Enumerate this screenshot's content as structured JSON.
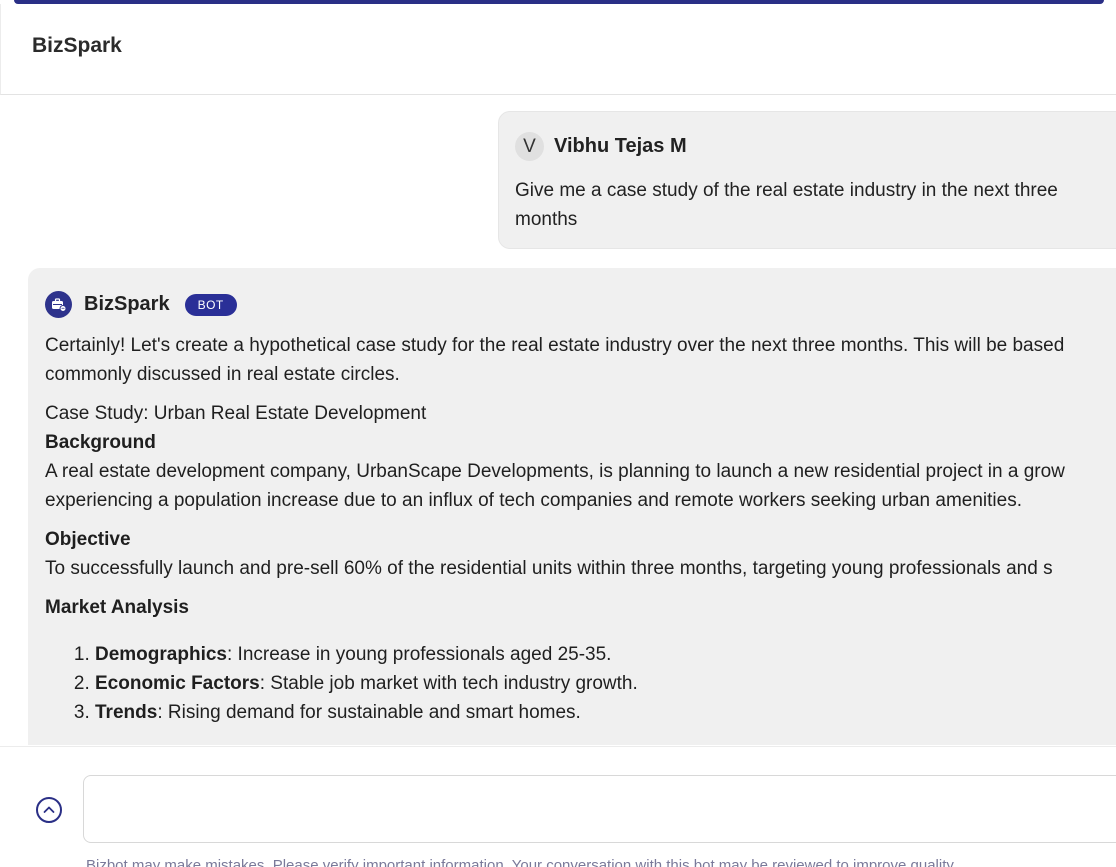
{
  "header": {
    "title": "BizSpark"
  },
  "user_message": {
    "avatar_initial": "V",
    "name": "Vibhu Tejas M",
    "text": "Give me a case study of the real estate industry in the next three months"
  },
  "bot_message": {
    "name": "BizSpark",
    "badge": "BOT",
    "intro_line1": "Certainly! Let's create a hypothetical case study for the real estate industry over the next three months. This will be based",
    "intro_line2": "commonly discussed in real estate circles.",
    "case_title": "Case Study: Urban Real Estate Development",
    "background_heading": "Background",
    "background_line1": "A real estate development company, UrbanScape Developments, is planning to launch a new residential project in a grow",
    "background_line2": "experiencing a population increase due to an influx of tech companies and remote workers seeking urban amenities.",
    "objective_heading": "Objective",
    "objective_text": "To successfully launch and pre-sell 60% of the residential units within three months, targeting young professionals and s",
    "market_heading": "Market Analysis",
    "market_items": [
      {
        "label": "Demographics",
        "text": ": Increase in young professionals aged 25-35."
      },
      {
        "label": "Economic Factors",
        "text": ": Stable job market with tech industry growth."
      },
      {
        "label": "Trends",
        "text": ": Rising demand for sustainable and smart homes."
      }
    ]
  },
  "input": {
    "value": "",
    "disclaimer": "Bizbot may make mistakes. Please verify important information. Your conversation with this bot may be reviewed to improve quality."
  },
  "icons": {
    "scroll": "chevron-up-circle-icon",
    "bot_avatar": "briefcase-bot-icon"
  },
  "colors": {
    "accent": "#2a2f86",
    "badge": "#2a2f97",
    "bubble": "#f0f0f0"
  }
}
